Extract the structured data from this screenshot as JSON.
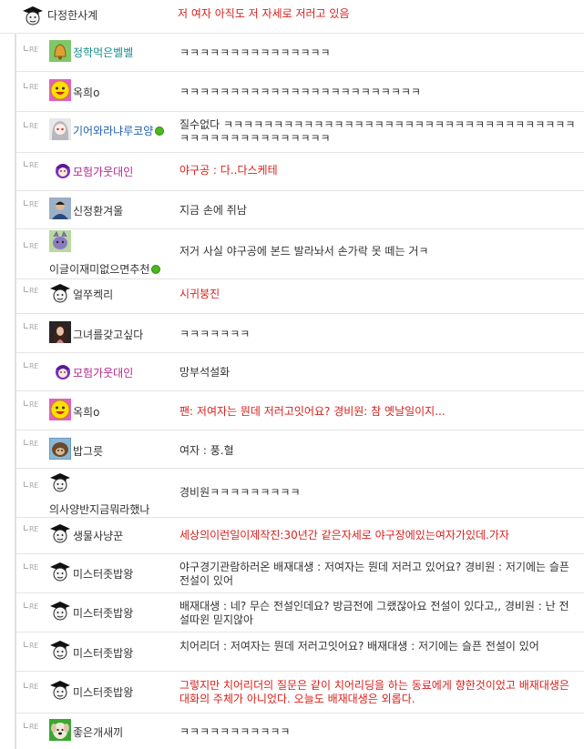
{
  "comments": [
    {
      "re": "",
      "name": "다정한사계",
      "name_color": "default",
      "avatar": "graduate-cap-avatar",
      "online": false,
      "text": "저 여자 아직도 저 자세로 저러고 있음",
      "highlight": true
    },
    {
      "re": "RE",
      "name": "정학먹은벨벨",
      "name_color": "teal",
      "avatar": "bell-avatar",
      "online": false,
      "text": "ㅋㅋㅋㅋㅋㅋㅋㅋㅋㅋㅋㅋㅋㅋㅋ",
      "highlight": false
    },
    {
      "re": "RE",
      "name": "옥희o",
      "name_color": "default",
      "avatar": "smiley-avatar",
      "online": false,
      "text": "ㅋㅋㅋㅋㅋㅋㅋㅋㅋㅋㅋㅋㅋㅋㅋㅋㅋㅋㅋㅋㅋㅋㅋㅋ",
      "highlight": false
    },
    {
      "re": "RE",
      "name": "기어와라냐루코양",
      "name_color": "blue",
      "avatar": "anime-girl-avatar",
      "online": true,
      "text": "질수없다 ㅋㅋㅋㅋㅋㅋㅋㅋㅋㅋㅋㅋㅋㅋㅋㅋㅋㅋㅋㅋㅋㅋㅋㅋㅋㅋㅋㅋㅋㅋㅋㅋㅋㅋㅋㅋㅋㅋㅋㅋㅋㅋㅋㅋㅋㅋㅋㅋㅋㅋ",
      "highlight": false
    },
    {
      "re": "RE",
      "name": "모험가웃대인",
      "name_color": "purple",
      "avatar": "purple-cap-avatar",
      "online": false,
      "text": "야구공 : 다..다스케테",
      "highlight": true
    },
    {
      "re": "RE",
      "name": "신정환겨울",
      "name_color": "default",
      "avatar": "photo-avatar",
      "online": false,
      "text": "지금 손에 쥐남",
      "highlight": false
    },
    {
      "re": "RE",
      "name": "이글이재미없으면추천",
      "name_color": "default",
      "avatar": "purple-creature-avatar",
      "online": true,
      "text": "저거 사실 야구공에 본드 발라놔서 손가락 못 떼는 거ㅋ",
      "highlight": false,
      "stacked": true
    },
    {
      "re": "RE",
      "name": "얼쭈켁리",
      "name_color": "default",
      "avatar": "graduate-cap-avatar",
      "online": false,
      "text": "시귀붕진",
      "highlight": true
    },
    {
      "re": "RE",
      "name": "그녀를갖고싶다",
      "name_color": "default",
      "avatar": "woman-photo-avatar",
      "online": false,
      "text": "ㅋㅋㅋㅋㅋㅋㅋ",
      "highlight": false
    },
    {
      "re": "RE",
      "name": "모험가웃대인",
      "name_color": "purple",
      "avatar": "purple-cap-avatar",
      "online": false,
      "text": "망부석설화",
      "highlight": false
    },
    {
      "re": "RE",
      "name": "옥희o",
      "name_color": "default",
      "avatar": "smiley-avatar",
      "online": false,
      "text": "팬: 저여자는 뭔데 저러고잇어요? 경비원: 참 옛날일이지...",
      "highlight": true
    },
    {
      "re": "RE",
      "name": "밥그릇",
      "name_color": "default",
      "avatar": "hedgehog-avatar",
      "online": false,
      "text": "여자 : 풍.혈",
      "highlight": false
    },
    {
      "re": "RE",
      "name": "의사양반지금뭐라했나",
      "name_color": "default",
      "avatar": "graduate-cap-avatar",
      "online": false,
      "text": "경비원ㅋㅋㅋㅋㅋㅋㅋㅋㅋ",
      "highlight": false,
      "stacked": true
    },
    {
      "re": "RE",
      "name": "생물사냥꾼",
      "name_color": "default",
      "avatar": "graduate-cap-avatar",
      "online": false,
      "text": "세상의이런일이제작진:30년간 같은자세로 야구장에있는여자가있데.가자",
      "highlight": true
    },
    {
      "re": "RE",
      "name": "미스터좃밥왕",
      "name_color": "default",
      "avatar": "graduate-cap-avatar",
      "online": false,
      "text": "야구경기관람하러온 배재대생 : 저여자는 뭔데 저러고 있어요? 경비원 : 저기에는 슬픈 전설이 있어",
      "highlight": false
    },
    {
      "re": "RE",
      "name": "미스터좃밥왕",
      "name_color": "default",
      "avatar": "graduate-cap-avatar",
      "online": false,
      "text": "배재대생 : 네? 무슨 전설인데요? 방금전에 그랬잖아요 전설이 있다고,, 경비원 : 난 전설따윈 믿지않아",
      "highlight": false
    },
    {
      "re": "RE",
      "name": "미스터좃밥왕",
      "name_color": "default",
      "avatar": "graduate-cap-avatar",
      "online": false,
      "text": "치어리더 : 저여자는 뭔데 저러고잇어요? 배재대생 : 저기에는 슬픈 전설이 있어",
      "highlight": false
    },
    {
      "re": "RE",
      "name": "미스터좃밥왕",
      "name_color": "default",
      "avatar": "graduate-cap-avatar",
      "online": false,
      "text": "그렇지만 치어리더의 질문은 같이 치어리딩을 하는 동료에게 향한것이었고 배재대생은 대화의 주체가 아니었다. 오늘도 배재대생은 외롭다.",
      "highlight": true
    },
    {
      "re": "RE",
      "name": "좋은개새끼",
      "name_color": "default",
      "avatar": "dog-avatar",
      "online": false,
      "text": "ㅋㅋㅋㅋㅋㅋㅋㅋㅋㅋㅋ",
      "highlight": false
    }
  ]
}
